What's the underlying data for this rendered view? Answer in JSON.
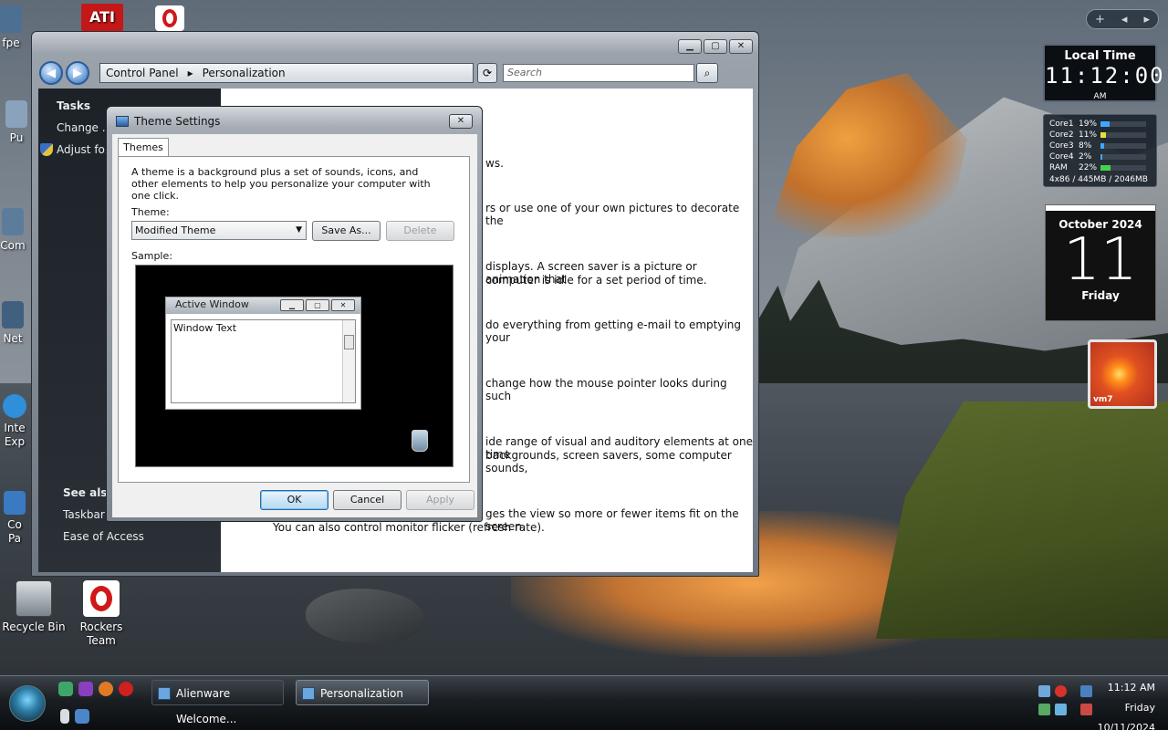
{
  "desktop": {
    "icons": [
      {
        "label": "Recycle Bin"
      },
      {
        "label": "Rockers Team"
      }
    ],
    "partial_labels": [
      "fpe",
      "Pu",
      "Com",
      "Net",
      "Inte",
      "Exp",
      "Co",
      "Pa"
    ]
  },
  "gadgets": {
    "clock": {
      "label": "Local Time",
      "time": "11:12:00",
      "ampm": "AM"
    },
    "cpu": {
      "cores": [
        {
          "name": "Core1",
          "percent": "19%",
          "level": 0.19
        },
        {
          "name": "Core2",
          "percent": "11%",
          "level": 0.11
        },
        {
          "name": "Core3",
          "percent": "8%",
          "level": 0.08
        },
        {
          "name": "Core4",
          "percent": "2%",
          "level": 0.02
        },
        {
          "name": "RAM",
          "percent": "22%",
          "level": 0.22
        }
      ],
      "footer": "4x86 / 445MB / 2046MB"
    },
    "calendar": {
      "month": "October 2024",
      "day": "11",
      "weekday": "Friday"
    },
    "photo": {
      "caption": "vm7"
    }
  },
  "window": {
    "title_crumbs": [
      "Control Panel",
      "Personalization"
    ],
    "search_placeholder": "Search",
    "sidebar": {
      "tasks_header": "Tasks",
      "tasks": [
        "Change ...",
        "Adjust fo..."
      ],
      "see_also_header": "See also",
      "see_also": [
        "Taskbar ...",
        "Ease of Access"
      ]
    },
    "content_lines": [
      "ws.",
      "rs or use one of your own pictures to decorate the",
      "displays. A screen saver is a picture or animation that",
      "computer is idle for a set period of time.",
      "do everything from getting e-mail to emptying your",
      "change how the mouse pointer looks during such",
      "ide range of visual and auditory elements at one time",
      "backgrounds, screen savers, some computer sounds,",
      "ges the view so more or fewer items fit on the screen.",
      "You can also control monitor flicker (refresh rate)."
    ]
  },
  "dialog": {
    "title": "Theme Settings",
    "tab": "Themes",
    "description": "A theme is a background plus a set of sounds, icons, and other elements to help you personalize your computer with one click.",
    "theme_label": "Theme:",
    "theme_value": "Modified Theme",
    "save_as": "Save As...",
    "delete": "Delete",
    "sample_label": "Sample:",
    "sample_window_title": "Active Window",
    "sample_window_text": "Window Text",
    "ok": "OK",
    "cancel": "Cancel",
    "apply": "Apply"
  },
  "taskbar": {
    "buttons": [
      {
        "label": "Alienware Welcome..."
      },
      {
        "label": "Personalization"
      }
    ],
    "clock": {
      "time": "11:12 AM",
      "weekday": "Friday",
      "date": "10/11/2024"
    }
  }
}
